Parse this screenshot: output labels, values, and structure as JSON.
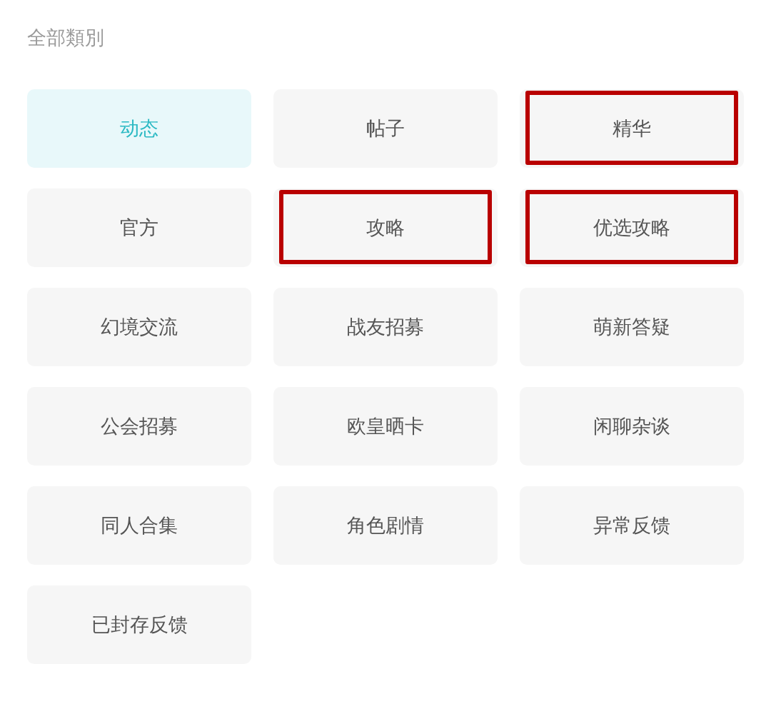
{
  "header": {
    "title": "全部類別"
  },
  "categories": [
    {
      "label": "动态",
      "selected": true,
      "highlighted": false
    },
    {
      "label": "帖子",
      "selected": false,
      "highlighted": false
    },
    {
      "label": "精华",
      "selected": false,
      "highlighted": true
    },
    {
      "label": "官方",
      "selected": false,
      "highlighted": false
    },
    {
      "label": "攻略",
      "selected": false,
      "highlighted": true
    },
    {
      "label": "优选攻略",
      "selected": false,
      "highlighted": true
    },
    {
      "label": "幻境交流",
      "selected": false,
      "highlighted": false
    },
    {
      "label": "战友招募",
      "selected": false,
      "highlighted": false
    },
    {
      "label": "萌新答疑",
      "selected": false,
      "highlighted": false
    },
    {
      "label": "公会招募",
      "selected": false,
      "highlighted": false
    },
    {
      "label": "欧皇晒卡",
      "selected": false,
      "highlighted": false
    },
    {
      "label": "闲聊杂谈",
      "selected": false,
      "highlighted": false
    },
    {
      "label": "同人合集",
      "selected": false,
      "highlighted": false
    },
    {
      "label": "角色剧情",
      "selected": false,
      "highlighted": false
    },
    {
      "label": "异常反馈",
      "selected": false,
      "highlighted": false
    },
    {
      "label": "已封存反馈",
      "selected": false,
      "highlighted": false
    }
  ]
}
